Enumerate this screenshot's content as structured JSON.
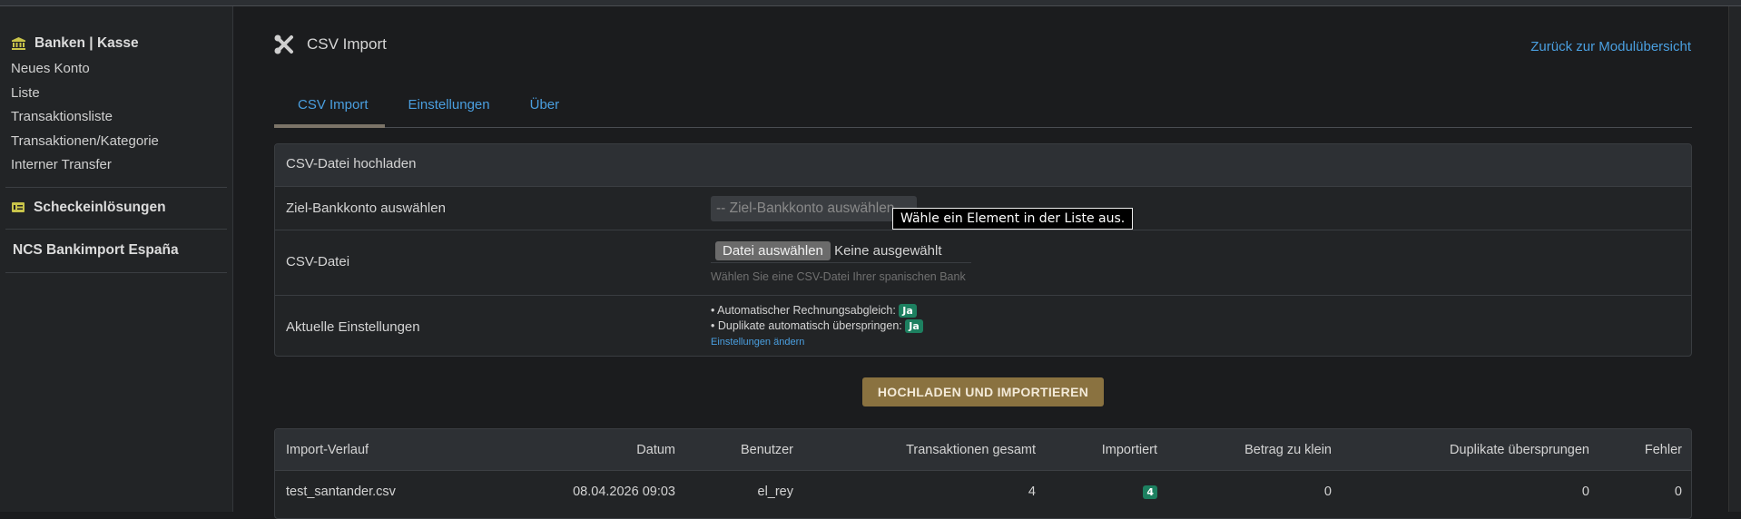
{
  "sidebar": {
    "sections": [
      {
        "title": "Banken | Kasse",
        "icon": "bank-icon",
        "items": [
          "Neues Konto",
          "Liste",
          "Transaktionsliste",
          "Transaktionen/Kategorie",
          "Interner Transfer"
        ]
      },
      {
        "title": "Scheckeinlösungen",
        "icon": "check-icon"
      },
      {
        "title": "NCS Bankimport España"
      }
    ]
  },
  "header": {
    "title": "CSV Import",
    "icon": "tools-icon",
    "back_link": "Zurück zur Modulübersicht"
  },
  "tabs": [
    {
      "label": "CSV Import",
      "active": true
    },
    {
      "label": "Einstellungen"
    },
    {
      "label": "Über"
    }
  ],
  "upload": {
    "heading": "CSV-Datei hochladen",
    "bank_label": "Ziel-Bankkonto auswählen",
    "bank_select": "-- Ziel-Bankkonto auswählen --",
    "tooltip": "Wähle ein Element in der Liste aus.",
    "file_label": "CSV-Datei",
    "file_button": "Datei auswählen",
    "file_status": "Keine ausgewählt",
    "file_hint": "Wählen Sie eine CSV-Datei Ihrer spanischen Bank",
    "settings_label": "Aktuelle Einstellungen",
    "setting1": "• Automatischer Rechnungsabgleich:",
    "setting1_value": "Ja",
    "setting2": "• Duplikate automatisch überspringen:",
    "setting2_value": "Ja",
    "settings_link": "Einstellungen ändern",
    "submit": "HOCHLADEN UND IMPORTIEREN"
  },
  "history": {
    "columns": [
      "Import-Verlauf",
      "Datum",
      "Benutzer",
      "Transaktionen gesamt",
      "Importiert",
      "Betrag zu klein",
      "Duplikate übersprungen",
      "Fehler"
    ],
    "rows": [
      [
        "test_santander.csv",
        "08.04.2026 09:03",
        "el_rey",
        "4",
        "4",
        "0",
        "0",
        "0"
      ]
    ]
  }
}
